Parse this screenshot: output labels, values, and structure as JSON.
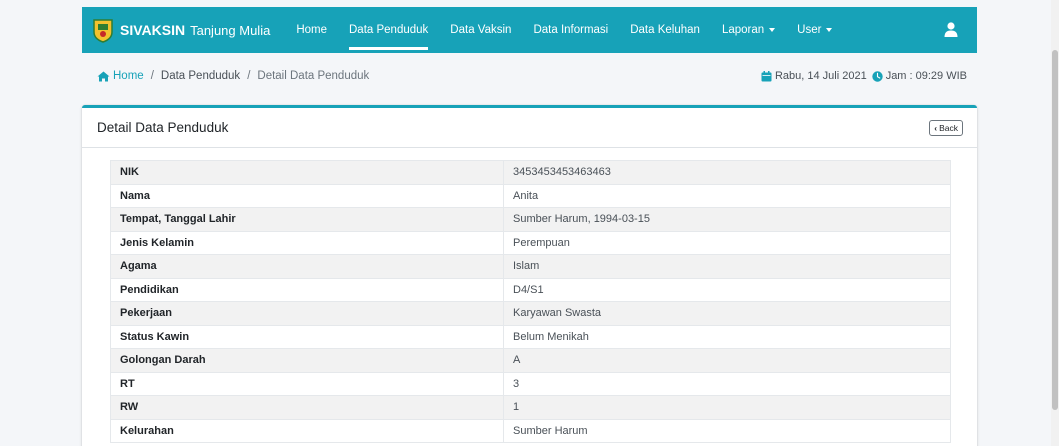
{
  "navbar": {
    "brand_bold": "SIVAKSIN",
    "brand_light": "Tanjung Mulia",
    "items": [
      {
        "label": "Home"
      },
      {
        "label": "Data Penduduk"
      },
      {
        "label": "Data Vaksin"
      },
      {
        "label": "Data Informasi"
      },
      {
        "label": "Data Keluhan"
      },
      {
        "label": "Laporan"
      },
      {
        "label": "User"
      }
    ],
    "active_index": 1,
    "accent_color": "#17a2b8"
  },
  "breadcrumb": {
    "items": [
      "Home",
      "Data Penduduk",
      "Detail Data Penduduk"
    ],
    "separator": "/"
  },
  "datetime": {
    "date": "Rabu, 14 Juli 2021",
    "time": "Jam : 09:29 WIB"
  },
  "card": {
    "title": "Detail Data Penduduk",
    "back_label": "Back"
  },
  "details": {
    "rows": [
      {
        "label": "NIK",
        "value": "3453453453463463"
      },
      {
        "label": "Nama",
        "value": "Anita"
      },
      {
        "label": "Tempat, Tanggal Lahir",
        "value": "Sumber Harum, 1994-03-15"
      },
      {
        "label": "Jenis Kelamin",
        "value": "Perempuan"
      },
      {
        "label": "Agama",
        "value": "Islam"
      },
      {
        "label": "Pendidikan",
        "value": "D4/S1"
      },
      {
        "label": "Pekerjaan",
        "value": "Karyawan Swasta"
      },
      {
        "label": "Status Kawin",
        "value": "Belum Menikah"
      },
      {
        "label": "Golongan Darah",
        "value": "A"
      },
      {
        "label": "RT",
        "value": "3"
      },
      {
        "label": "RW",
        "value": "1"
      },
      {
        "label": "Kelurahan",
        "value": "Sumber Harum"
      }
    ]
  }
}
